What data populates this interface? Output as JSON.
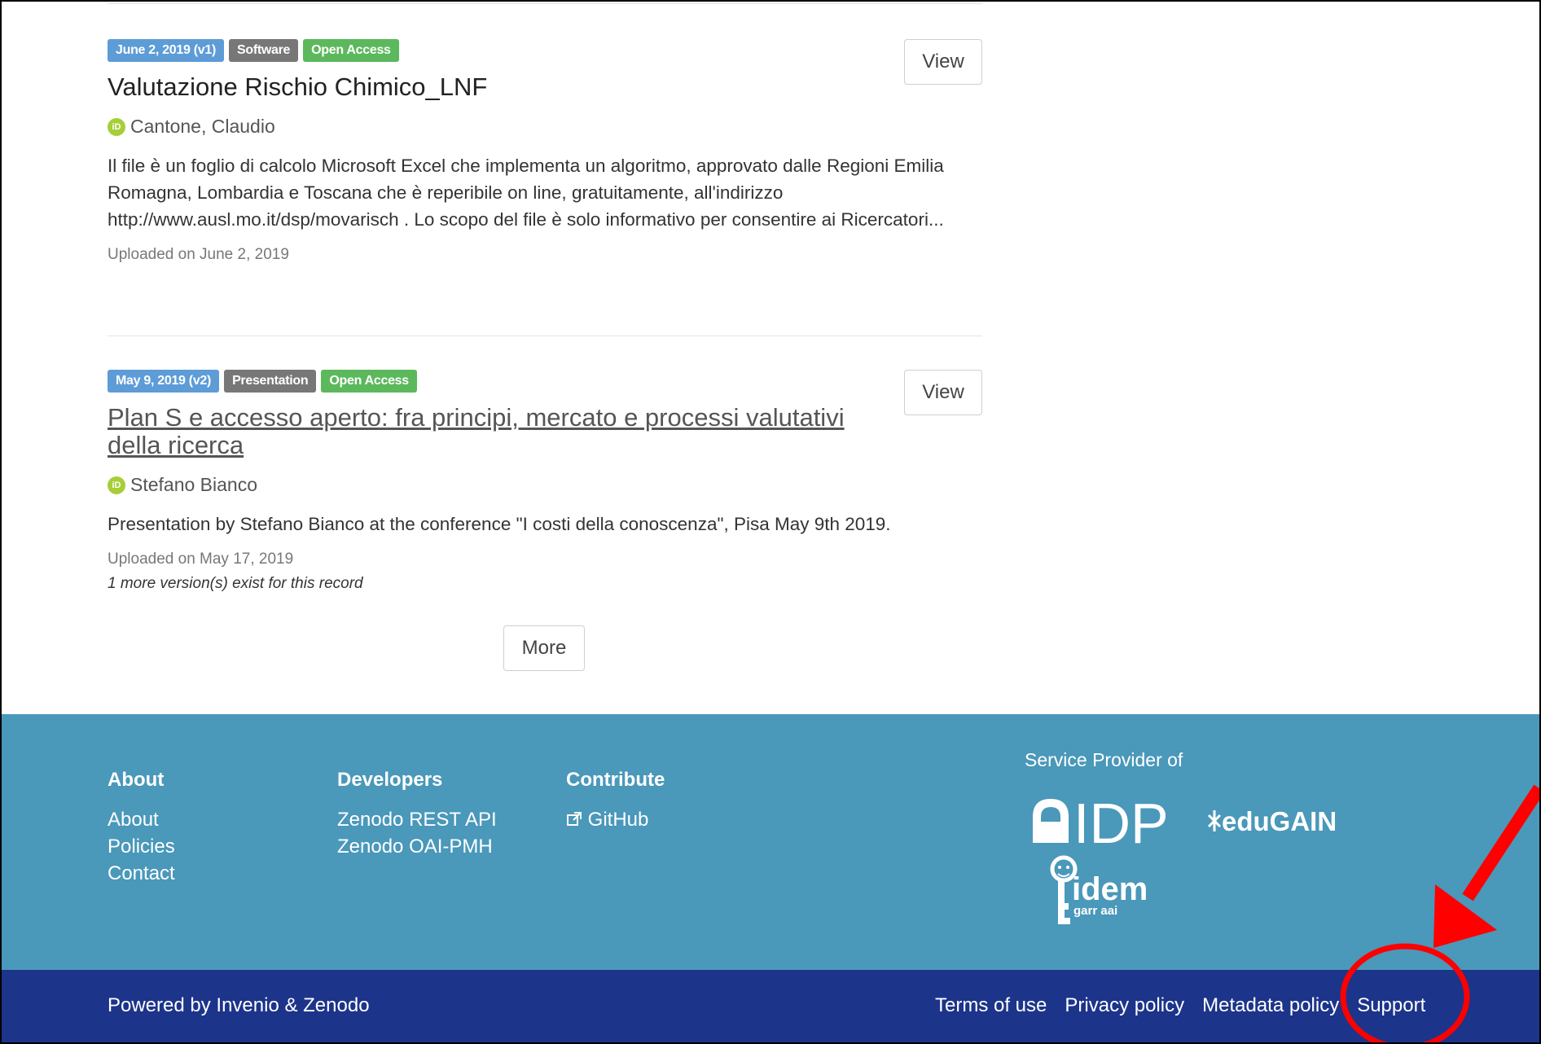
{
  "records": [
    {
      "badges": {
        "date": "June 2, 2019 (v1)",
        "type": "Software",
        "access": "Open Access"
      },
      "view_label": "View",
      "title": "Valutazione Rischio Chimico_LNF",
      "author": "Cantone, Claudio",
      "description": "Il file è un foglio di calcolo Microsoft Excel che implementa un algoritmo, approvato dalle Regioni Emilia Romagna, Lombardia e Toscana che è reperibile on line, gratuitamente, all'indirizzo http://www.ausl.mo.it/dsp/movarisch . Lo scopo del file è solo informativo per consentire ai Ricercatori...",
      "uploaded": "Uploaded on June 2, 2019"
    },
    {
      "badges": {
        "date": "May 9, 2019 (v2)",
        "type": "Presentation",
        "access": "Open Access"
      },
      "view_label": "View",
      "title": "Plan S e accesso aperto: fra principi, mercato e processi valutativi della ricerca",
      "author": "Stefano Bianco",
      "description": "Presentation by Stefano Bianco at the conference \"I costi della conoscenza\", Pisa May 9th 2019.",
      "uploaded": "Uploaded on May 17, 2019",
      "versions_note": "1 more version(s) exist for this record"
    }
  ],
  "more_label": "More",
  "footer": {
    "columns": [
      {
        "heading": "About",
        "links": [
          "About",
          "Policies",
          "Contact"
        ]
      },
      {
        "heading": "Developers",
        "links": [
          "Zenodo REST API",
          "Zenodo OAI-PMH"
        ]
      },
      {
        "heading": "Contribute",
        "links": [
          "GitHub"
        ]
      }
    ],
    "service_provider": "Service Provider of",
    "logos": {
      "idp": "IDP",
      "edugain": "eduGAIN",
      "idem": "idem",
      "idem_sub": "garr aai"
    },
    "powered_by": "Powered by Invenio & Zenodo",
    "bottom_links": [
      "Terms of use",
      "Privacy policy",
      "Metadata policy",
      "Support"
    ]
  },
  "colors": {
    "badge_date": "#5d9cd6",
    "badge_type": "#777777",
    "badge_access": "#5cb85c",
    "footer_top": "#4a98ba",
    "footer_bottom": "#1c348a",
    "annotation": "#ff0000"
  },
  "icons": [
    "orcid-icon",
    "external-link-icon"
  ]
}
